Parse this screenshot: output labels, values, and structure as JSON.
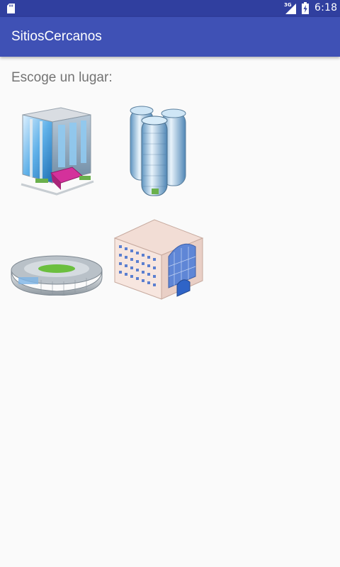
{
  "status_bar": {
    "network_label": "3G",
    "time": "6:18",
    "icons": [
      "sd-card-icon",
      "signal-icon",
      "battery-charging-icon"
    ],
    "color": "#303f9f"
  },
  "app_bar": {
    "title": "SitiosCercanos",
    "color": "#3f51b5"
  },
  "main": {
    "prompt": "Escoge un lugar:",
    "places": [
      {
        "id": "hotel",
        "icon": "hotel-building-icon"
      },
      {
        "id": "towers",
        "icon": "skyscrapers-icon"
      },
      {
        "id": "stadium",
        "icon": "stadium-icon"
      },
      {
        "id": "office",
        "icon": "office-building-icon"
      }
    ]
  }
}
